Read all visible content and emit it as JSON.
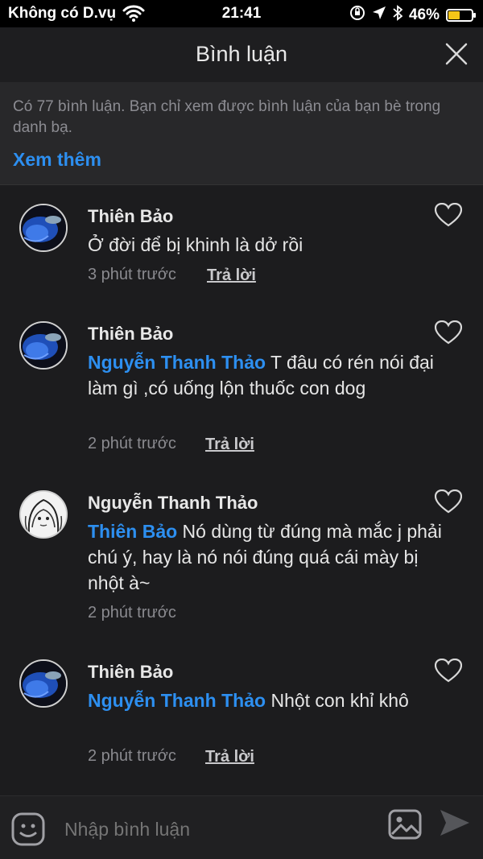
{
  "status_bar": {
    "carrier": "Không có D.vụ",
    "time": "21:41",
    "battery": "46%",
    "battery_level": 0.46,
    "icons": [
      "wifi-icon",
      "orientation-lock-icon",
      "location-icon",
      "bluetooth-icon",
      "battery-icon"
    ]
  },
  "header": {
    "title": "Bình luận",
    "close_icon": "close-icon"
  },
  "notice": {
    "text": "Có 77 bình luận. Bạn chỉ xem được bình luận của bạn bè trong danh bạ.",
    "more_label": "Xem thêm"
  },
  "comments": [
    {
      "author": "Thiên Bảo",
      "mention": "",
      "text": "Ở đời để bị khinh là dở rồi",
      "time": "3 phút trước",
      "reply_label": "Trả lời",
      "avatar": "fish-avatar"
    },
    {
      "author": "Thiên Bảo",
      "mention": "Nguyễn Thanh Thảo",
      "text": " T đâu có rén nói đại làm gì ,có uống lộn thuốc con dog",
      "time": "2 phút trước",
      "reply_label": "Trả lời",
      "avatar": "fish-avatar"
    },
    {
      "author": "Nguyễn Thanh Thảo",
      "mention": "Thiên Bảo",
      "text": " Nó dùng từ đúng mà mắc j phải chú ý, hay là nó nói đúng quá cái mày bị nhột à~",
      "time": "2 phút trước",
      "reply_label": "",
      "avatar": "sketch-avatar"
    },
    {
      "author": "Thiên Bảo",
      "mention": "Nguyễn Thanh Thảo",
      "text": " Nhột con khỉ khô",
      "time": "2 phút trước",
      "reply_label": "Trả lời",
      "avatar": "fish-avatar"
    }
  ],
  "composer": {
    "placeholder": "Nhập bình luận",
    "icons": [
      "emoji-icon",
      "image-icon",
      "send-icon"
    ]
  },
  "colors": {
    "accent": "#2d8ff0",
    "background": "#1c1c1e",
    "notice_bg": "#28282a",
    "battery": "#f5c518"
  }
}
